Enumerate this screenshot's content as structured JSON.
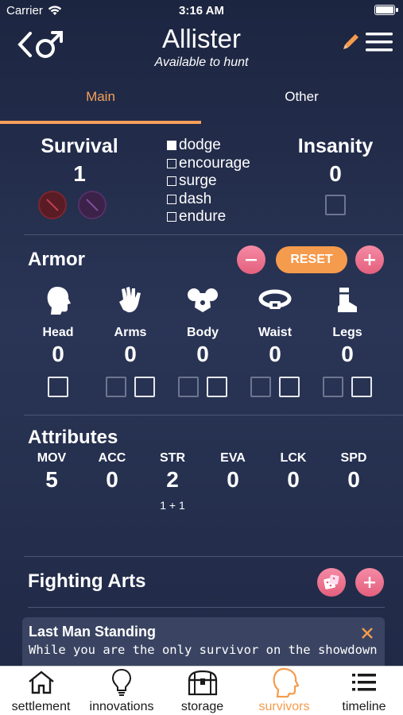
{
  "status_bar": {
    "carrier": "Carrier",
    "time": "3:16 AM"
  },
  "header": {
    "name": "Allister",
    "subtitle": "Available to hunt",
    "icons": [
      "back-chevron-icon",
      "male-symbol-icon",
      "pencil-icon",
      "menu-icon"
    ]
  },
  "tabs": [
    {
      "label": "Main",
      "active": true
    },
    {
      "label": "Other",
      "active": false
    }
  ],
  "survival": {
    "label": "Survival",
    "value": "1",
    "actions": [
      {
        "label": "dodge",
        "checked": true
      },
      {
        "label": "encourage",
        "checked": false
      },
      {
        "label": "surge",
        "checked": false
      },
      {
        "label": "dash",
        "checked": false
      },
      {
        "label": "endure",
        "checked": false
      }
    ]
  },
  "insanity": {
    "label": "Insanity",
    "value": "0"
  },
  "armor": {
    "title": "Armor",
    "reset_label": "RESET",
    "slots": [
      {
        "label": "Head",
        "value": "0",
        "icon": "head-icon"
      },
      {
        "label": "Arms",
        "value": "0",
        "icon": "gauntlet-icon"
      },
      {
        "label": "Body",
        "value": "0",
        "icon": "chest-armor-icon"
      },
      {
        "label": "Waist",
        "value": "0",
        "icon": "belt-icon"
      },
      {
        "label": "Legs",
        "value": "0",
        "icon": "boot-icon"
      }
    ]
  },
  "attributes": {
    "title": "Attributes",
    "items": [
      {
        "label": "MOV",
        "value": "5",
        "note": ""
      },
      {
        "label": "ACC",
        "value": "0",
        "note": ""
      },
      {
        "label": "STR",
        "value": "2",
        "note": "1 + 1"
      },
      {
        "label": "EVA",
        "value": "0",
        "note": ""
      },
      {
        "label": "LCK",
        "value": "0",
        "note": ""
      },
      {
        "label": "SPD",
        "value": "0",
        "note": ""
      }
    ]
  },
  "fighting_arts": {
    "title": "Fighting Arts",
    "cards": [
      {
        "name": "Last Man Standing",
        "description": "While you are the only survivor on the showdown"
      }
    ]
  },
  "tabbar": [
    {
      "label": "settlement",
      "icon": "house-icon",
      "active": false
    },
    {
      "label": "innovations",
      "icon": "lightbulb-icon",
      "active": false
    },
    {
      "label": "storage",
      "icon": "chest-icon",
      "active": false
    },
    {
      "label": "survivors",
      "icon": "survivor-head-icon",
      "active": true
    },
    {
      "label": "timeline",
      "icon": "list-icon",
      "active": false
    }
  ],
  "colors": {
    "accent": "#f59b4d",
    "pink": "#e86f8d",
    "background": "#243050"
  }
}
